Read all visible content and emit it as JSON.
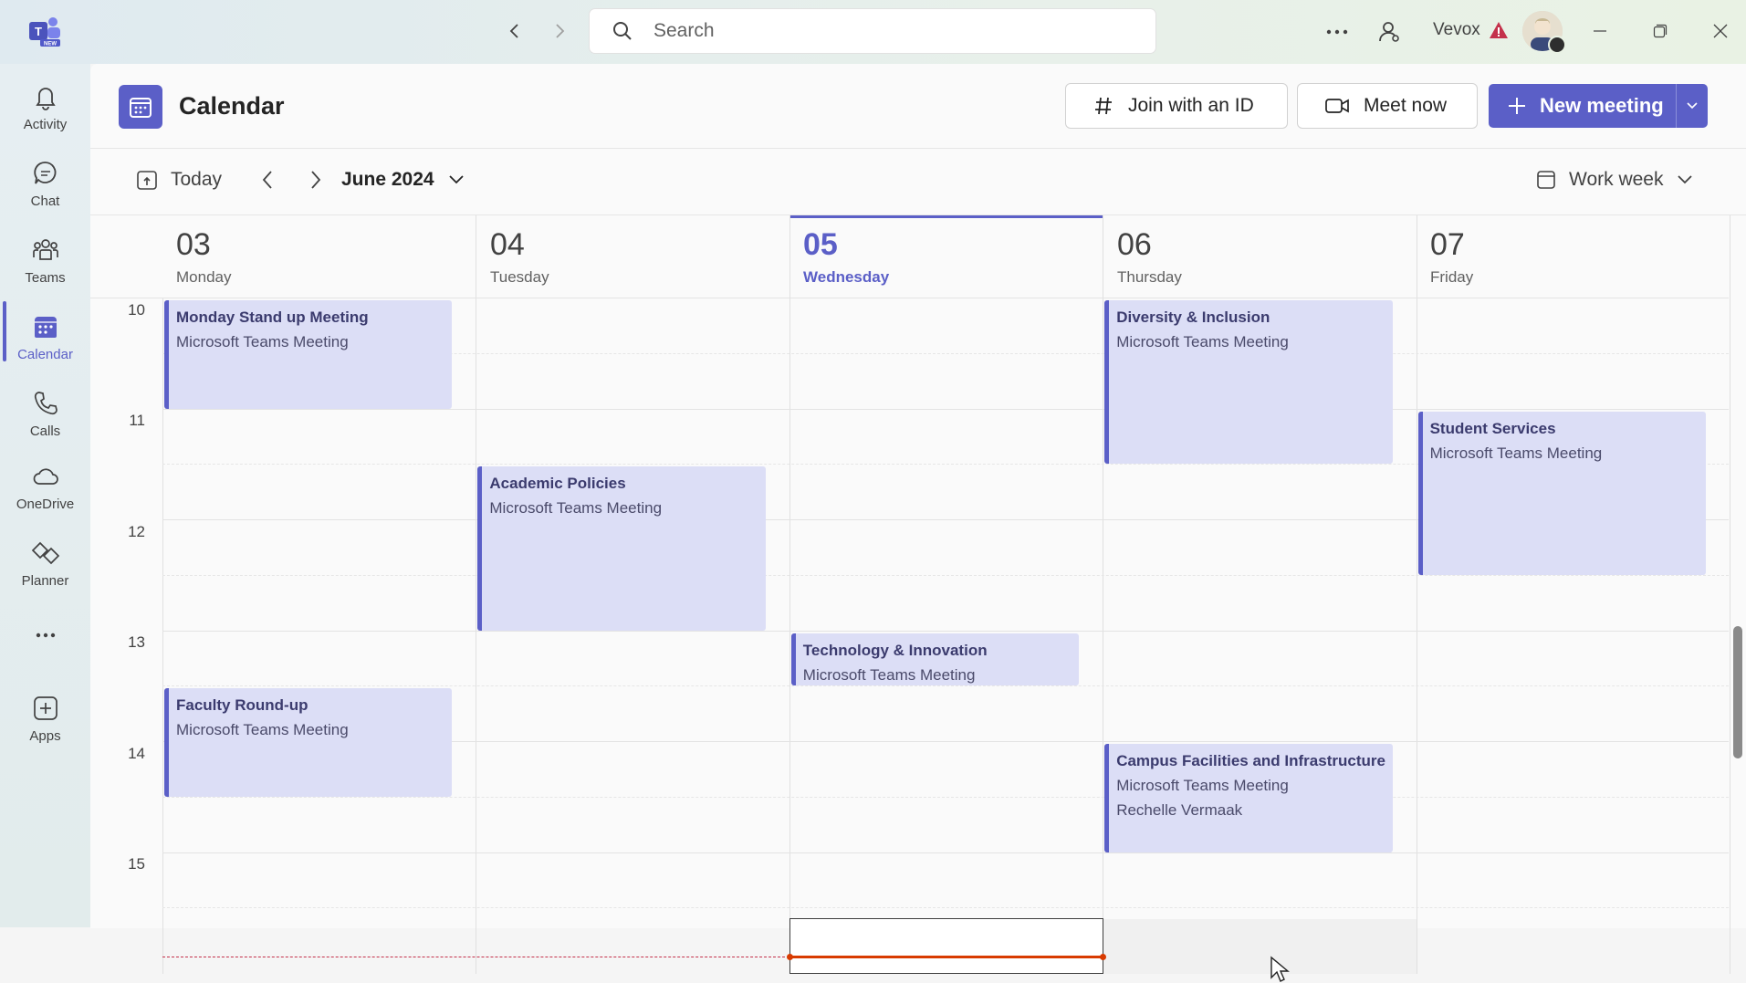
{
  "app": {
    "name": "Microsoft Teams"
  },
  "titlebar": {
    "search_placeholder": "Search",
    "org_name": "Vevox",
    "icons": [
      "teams-logo-icon",
      "back-icon",
      "forward-icon",
      "search-icon",
      "more-options-icon",
      "people-icon",
      "warning-icon",
      "minimize-icon",
      "restore-icon",
      "close-icon"
    ]
  },
  "rail": {
    "items": [
      {
        "label": "Activity",
        "icon": "bell-icon"
      },
      {
        "label": "Chat",
        "icon": "chat-icon"
      },
      {
        "label": "Teams",
        "icon": "teams-icon"
      },
      {
        "label": "Calendar",
        "icon": "calendar-icon",
        "active": true
      },
      {
        "label": "Calls",
        "icon": "phone-icon"
      },
      {
        "label": "OneDrive",
        "icon": "cloud-icon"
      },
      {
        "label": "Planner",
        "icon": "planner-icon"
      },
      {
        "label": "",
        "icon": "more-apps-icon"
      },
      {
        "label": "Apps",
        "icon": "add-app-icon"
      }
    ]
  },
  "header": {
    "title": "Calendar",
    "join_label": "Join with an ID",
    "meet_now_label": "Meet now",
    "new_meeting_label": "New meeting"
  },
  "toolbar": {
    "today_label": "Today",
    "month_label": "June 2024",
    "view_label": "Work week"
  },
  "days": [
    {
      "num": "03",
      "dow": "Monday"
    },
    {
      "num": "04",
      "dow": "Tuesday"
    },
    {
      "num": "05",
      "dow": "Wednesday",
      "today": true
    },
    {
      "num": "06",
      "dow": "Thursday"
    },
    {
      "num": "07",
      "dow": "Friday"
    }
  ],
  "hours": [
    "10",
    "11",
    "12",
    "13",
    "14",
    "15"
  ],
  "events": [
    {
      "title": "Monday Stand up Meeting",
      "lines": [
        "Microsoft Teams Meeting"
      ],
      "day": 0,
      "start": 10.0,
      "end": 11.0
    },
    {
      "title": "Faculty Round-up",
      "lines": [
        "Microsoft Teams Meeting"
      ],
      "day": 0,
      "start": 13.5,
      "end": 14.5
    },
    {
      "title": "Academic Policies",
      "lines": [
        "Microsoft Teams Meeting"
      ],
      "day": 1,
      "start": 11.5,
      "end": 13.0
    },
    {
      "title": "Technology & Innovation",
      "lines": [
        "Microsoft Teams Meeting"
      ],
      "day": 2,
      "start": 13.0,
      "end": 13.5
    },
    {
      "title": "Diversity & Inclusion",
      "lines": [
        "Microsoft Teams Meeting"
      ],
      "day": 3,
      "start": 10.0,
      "end": 11.5
    },
    {
      "title": "Campus Facilities and Infrastructure",
      "lines": [
        "Microsoft Teams Meeting",
        "Rechelle Vermaak"
      ],
      "day": 3,
      "start": 14.0,
      "end": 15.0
    },
    {
      "title": "Student Services",
      "lines": [
        "Microsoft Teams Meeting"
      ],
      "day": 4,
      "start": 11.0,
      "end": 12.5
    }
  ],
  "colors": {
    "accent": "#5b5fc7",
    "event_fill": "#dcdef6",
    "now_line": "#d83b01"
  }
}
